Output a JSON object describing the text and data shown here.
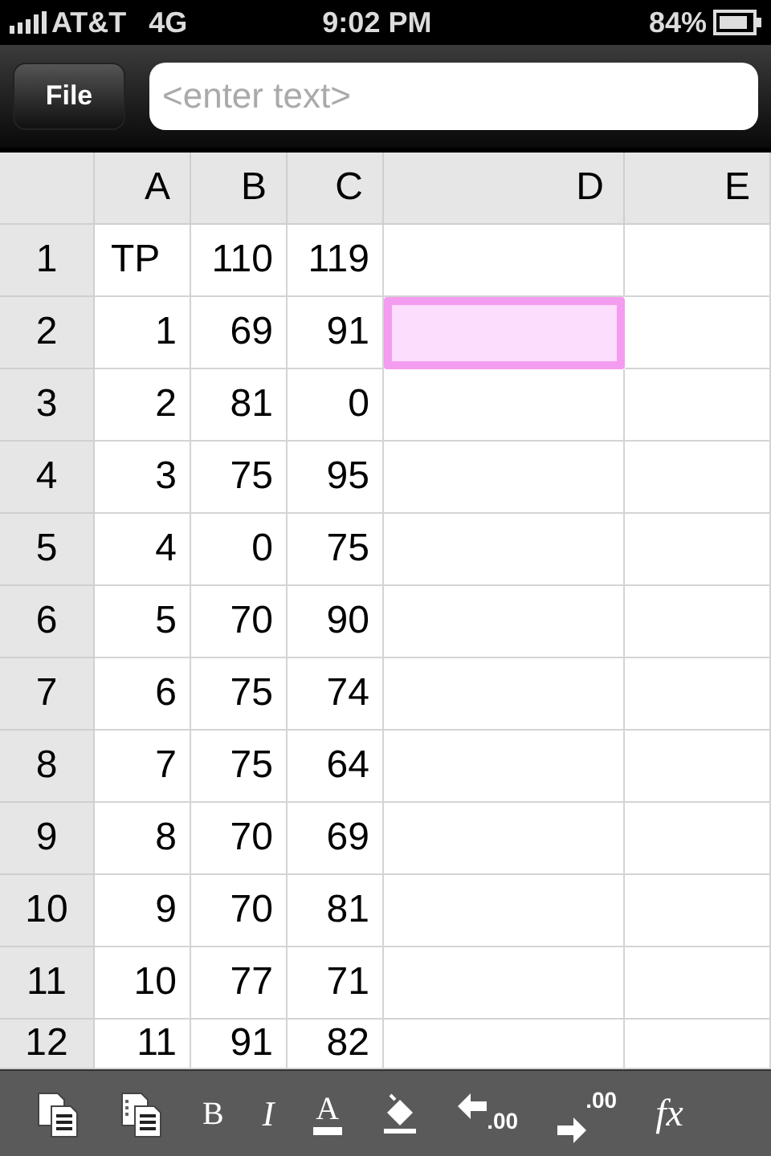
{
  "status_bar": {
    "carrier": "AT&T",
    "network": "4G",
    "time": "9:02 PM",
    "battery": "84%"
  },
  "toolbar": {
    "file_button": "File",
    "formula_field": {
      "placeholder": "<enter text>"
    }
  },
  "columns": [
    "A",
    "B",
    "C",
    "D",
    "E"
  ],
  "rows": [
    {
      "label": "1",
      "cells": [
        {
          "text": "TP",
          "kind": "text",
          "selected": false
        },
        {
          "text": "110",
          "kind": "number",
          "selected": false
        },
        {
          "text": "119",
          "kind": "number",
          "selected": false
        },
        {
          "selected": false
        },
        {
          "selected": false
        }
      ]
    },
    {
      "label": "2",
      "cells": [
        {
          "text": "1",
          "kind": "number",
          "selected": false
        },
        {
          "text": "69",
          "kind": "number",
          "selected": false
        },
        {
          "text": "91",
          "kind": "number",
          "selected": false
        },
        {
          "selected": true
        },
        {
          "selected": false
        }
      ]
    },
    {
      "label": "3",
      "cells": [
        {
          "text": "2",
          "kind": "number",
          "selected": false
        },
        {
          "text": "81",
          "kind": "number",
          "selected": false
        },
        {
          "text": "0",
          "kind": "number",
          "selected": false
        },
        {
          "selected": false
        },
        {
          "selected": false
        }
      ]
    },
    {
      "label": "4",
      "cells": [
        {
          "text": "3",
          "kind": "number",
          "selected": false
        },
        {
          "text": "75",
          "kind": "number",
          "selected": false
        },
        {
          "text": "95",
          "kind": "number",
          "selected": false
        },
        {
          "selected": false
        },
        {
          "selected": false
        }
      ]
    },
    {
      "label": "5",
      "cells": [
        {
          "text": "4",
          "kind": "number",
          "selected": false
        },
        {
          "text": "0",
          "kind": "number",
          "selected": false
        },
        {
          "text": "75",
          "kind": "number",
          "selected": false
        },
        {
          "selected": false
        },
        {
          "selected": false
        }
      ]
    },
    {
      "label": "6",
      "cells": [
        {
          "text": "5",
          "kind": "number",
          "selected": false
        },
        {
          "text": "70",
          "kind": "number",
          "selected": false
        },
        {
          "text": "90",
          "kind": "number",
          "selected": false
        },
        {
          "selected": false
        },
        {
          "selected": false
        }
      ]
    },
    {
      "label": "7",
      "cells": [
        {
          "text": "6",
          "kind": "number",
          "selected": false
        },
        {
          "text": "75",
          "kind": "number",
          "selected": false
        },
        {
          "text": "74",
          "kind": "number",
          "selected": false
        },
        {
          "selected": false
        },
        {
          "selected": false
        }
      ]
    },
    {
      "label": "8",
      "cells": [
        {
          "text": "7",
          "kind": "number",
          "selected": false
        },
        {
          "text": "75",
          "kind": "number",
          "selected": false
        },
        {
          "text": "64",
          "kind": "number",
          "selected": false
        },
        {
          "selected": false
        },
        {
          "selected": false
        }
      ]
    },
    {
      "label": "9",
      "cells": [
        {
          "text": "8",
          "kind": "number",
          "selected": false
        },
        {
          "text": "70",
          "kind": "number",
          "selected": false
        },
        {
          "text": "69",
          "kind": "number",
          "selected": false
        },
        {
          "selected": false
        },
        {
          "selected": false
        }
      ]
    },
    {
      "label": "10",
      "cells": [
        {
          "text": "9",
          "kind": "number",
          "selected": false
        },
        {
          "text": "70",
          "kind": "number",
          "selected": false
        },
        {
          "text": "81",
          "kind": "number",
          "selected": false
        },
        {
          "selected": false
        },
        {
          "selected": false
        }
      ]
    },
    {
      "label": "11",
      "cells": [
        {
          "text": "10",
          "kind": "number",
          "selected": false
        },
        {
          "text": "77",
          "kind": "number",
          "selected": false
        },
        {
          "text": "71",
          "kind": "number",
          "selected": false
        },
        {
          "selected": false
        },
        {
          "selected": false
        }
      ]
    },
    {
      "label": "12",
      "cells": [
        {
          "text": "11",
          "kind": "number",
          "selected": false
        },
        {
          "text": "91",
          "kind": "number",
          "selected": false
        },
        {
          "text": "82",
          "kind": "number",
          "selected": false
        },
        {
          "selected": false
        },
        {
          "selected": false
        }
      ]
    }
  ],
  "format_bar": [
    {
      "kind": "copy"
    },
    {
      "kind": "paste"
    },
    {
      "kind": "bold",
      "label": "B"
    },
    {
      "kind": "italic",
      "label": "I"
    },
    {
      "kind": "underline",
      "label": "A"
    },
    {
      "kind": "fill"
    },
    {
      "kind": "decrease_decimal",
      "label": ".00"
    },
    {
      "kind": "increase_decimal",
      "label": ".00"
    },
    {
      "kind": "function",
      "label": "fx"
    }
  ]
}
